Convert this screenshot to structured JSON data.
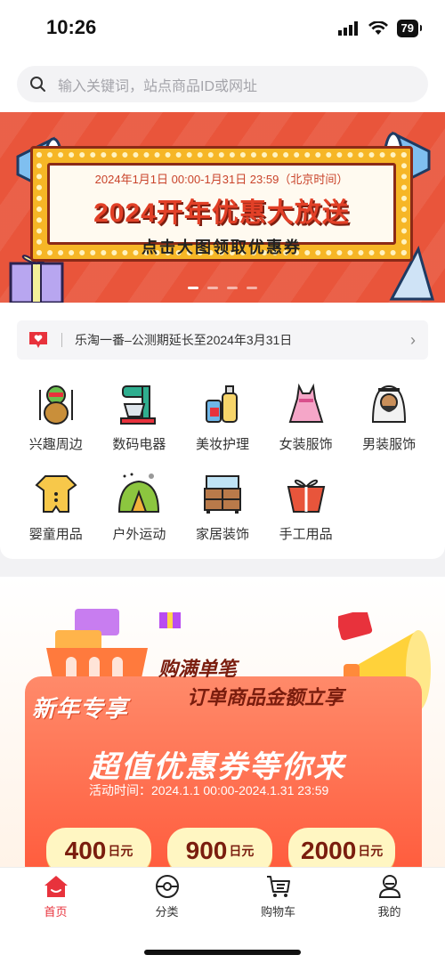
{
  "status": {
    "time": "10:26",
    "battery": "79"
  },
  "search": {
    "placeholder": "输入关键词，站点商品ID或网址"
  },
  "banner": {
    "date_range": "2024年1月1日 00:00-1月31日 23:59（北京时间）",
    "title": "2024开年优惠大放送",
    "subtitle": "点击大图领取优惠券",
    "active_slide": 1,
    "slide_count": 4
  },
  "notice": {
    "text": "乐淘一番–公测期延长至2024年3月31日"
  },
  "categories": [
    {
      "label": "兴趣周边",
      "icon": "turtle-figure-icon"
    },
    {
      "label": "数码电器",
      "icon": "stand-mixer-icon"
    },
    {
      "label": "美妆护理",
      "icon": "cosmetics-bottles-icon"
    },
    {
      "label": "女装服饰",
      "icon": "dress-icon"
    },
    {
      "label": "男装服饰",
      "icon": "man-headwear-icon"
    },
    {
      "label": "婴童用品",
      "icon": "baby-onesie-icon"
    },
    {
      "label": "户外运动",
      "icon": "tent-icon"
    },
    {
      "label": "家居装饰",
      "icon": "dresser-icon"
    },
    {
      "label": "手工用品",
      "icon": "gift-wrap-icon"
    }
  ],
  "promo": {
    "tag": "新年专享",
    "line1": "购满单笔",
    "line2": "订单商品金额立享",
    "headline": "超值优惠券等你来",
    "time": "活动时间：2024.1.1 00:00-2024.1.31 23:59",
    "coupons": [
      {
        "amount": "400",
        "unit": "日元"
      },
      {
        "amount": "900",
        "unit": "日元"
      },
      {
        "amount": "2000",
        "unit": "日元"
      }
    ]
  },
  "tabbar": {
    "items": [
      {
        "label": "首页",
        "icon": "home-icon",
        "active": true
      },
      {
        "label": "分类",
        "icon": "category-icon",
        "active": false
      },
      {
        "label": "购物车",
        "icon": "cart-icon",
        "active": false
      },
      {
        "label": "我的",
        "icon": "profile-icon",
        "active": false
      }
    ]
  },
  "colors": {
    "accent": "#e8323c",
    "banner_bg": "#e9553b",
    "promo_card": "#ff5a3b"
  }
}
